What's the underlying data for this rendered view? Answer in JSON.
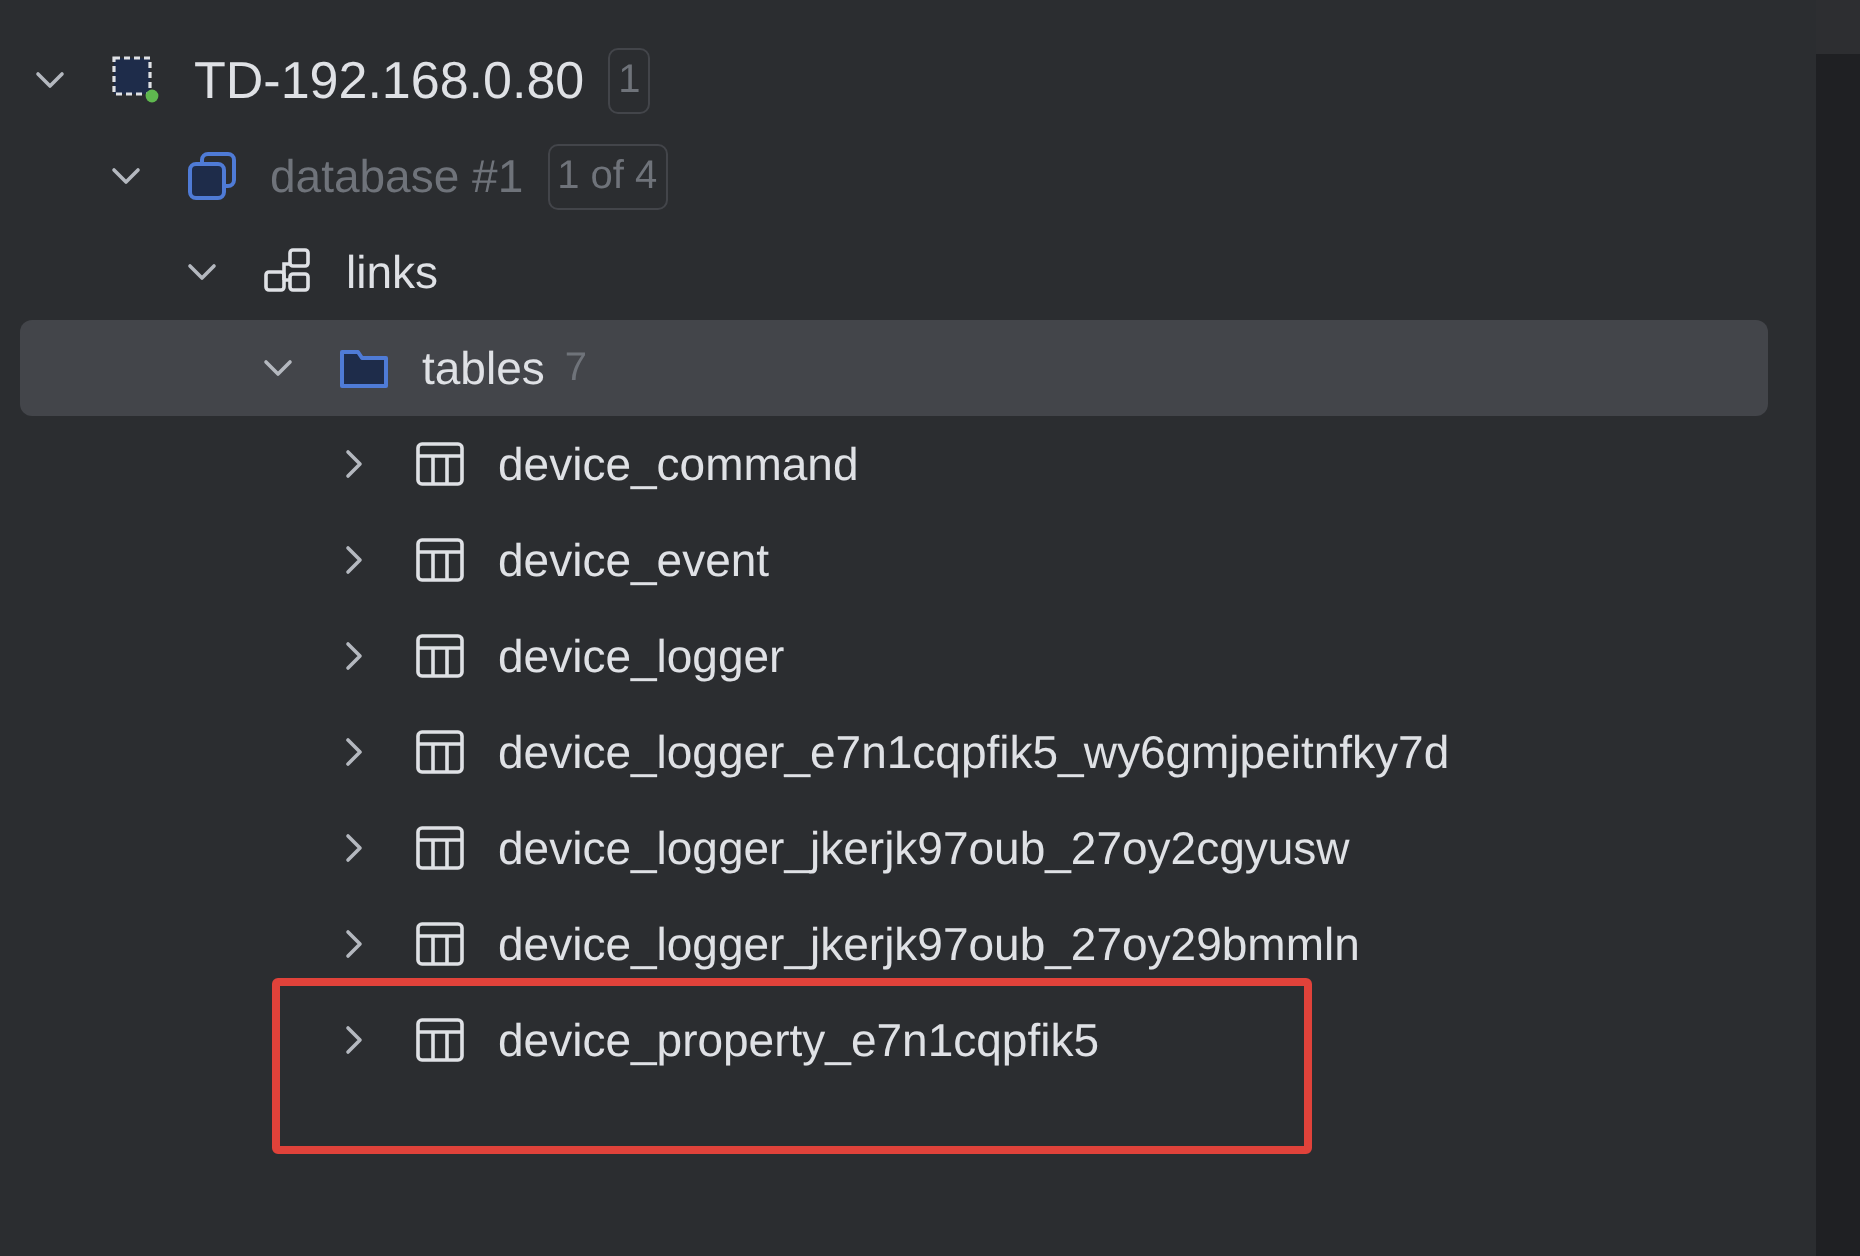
{
  "tree": [
    {
      "kind": "connection",
      "label": "TD-192.168.0.80",
      "badge": "1",
      "expanded": true,
      "selected": false,
      "highlighted": false,
      "children": [
        {
          "kind": "database",
          "label": "database #1",
          "badge": "1 of 4",
          "expanded": true,
          "selected": false,
          "highlighted": false,
          "children": [
            {
              "kind": "schema",
              "label": "links",
              "expanded": true,
              "selected": false,
              "highlighted": false,
              "children": [
                {
                  "kind": "folder",
                  "label": "tables",
                  "count": "7",
                  "expanded": true,
                  "selected": true,
                  "highlighted": false,
                  "children": [
                    {
                      "kind": "table",
                      "label": "device_command",
                      "expanded": false,
                      "selected": false,
                      "highlighted": false
                    },
                    {
                      "kind": "table",
                      "label": "device_event",
                      "expanded": false,
                      "selected": false,
                      "highlighted": false
                    },
                    {
                      "kind": "table",
                      "label": "device_logger",
                      "expanded": false,
                      "selected": false,
                      "highlighted": false
                    },
                    {
                      "kind": "table",
                      "label": "device_logger_e7n1cqpfik5_wy6gmjpeitnfky7d",
                      "expanded": false,
                      "selected": false,
                      "highlighted": false
                    },
                    {
                      "kind": "table",
                      "label": "device_logger_jkerjk97oub_27oy2cgyusw",
                      "expanded": false,
                      "selected": false,
                      "highlighted": false
                    },
                    {
                      "kind": "table",
                      "label": "device_logger_jkerjk97oub_27oy29bmmln",
                      "expanded": false,
                      "selected": false,
                      "highlighted": false
                    },
                    {
                      "kind": "table",
                      "label": "device_property_e7n1cqpfik5",
                      "expanded": false,
                      "selected": false,
                      "highlighted": true
                    }
                  ]
                }
              ]
            }
          ]
        }
      ]
    }
  ]
}
